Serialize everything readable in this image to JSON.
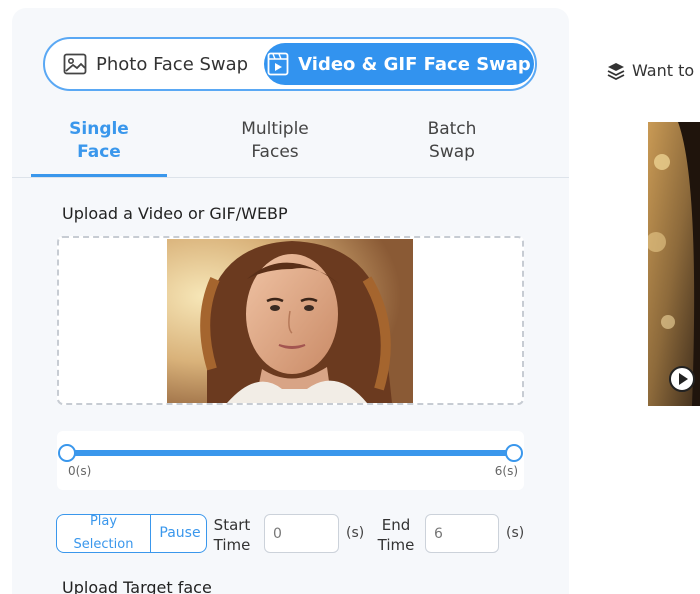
{
  "mode_toggle": {
    "photo_label": "Photo Face Swap",
    "video_label": "Video & GIF Face Swap",
    "active": "video"
  },
  "tabs": [
    {
      "line1": "Single",
      "line2": "Face",
      "active": true
    },
    {
      "line1": "Multiple",
      "line2": "Faces",
      "active": false
    },
    {
      "line1": "Batch",
      "line2": "Swap",
      "active": false
    }
  ],
  "upload": {
    "label": "Upload a Video or GIF/WEBP"
  },
  "trim": {
    "start_label": "0(s)",
    "end_label": "6(s)",
    "selection_fraction": [
      0,
      1
    ],
    "play_line1": "Play",
    "play_line2": "Selection",
    "pause_label": "Pause",
    "start_time_line1": "Start",
    "start_time_line2": "Time",
    "start_value": "0",
    "end_time_line1": "End",
    "end_time_line2": "Time",
    "end_value": "6",
    "unit": "(s)"
  },
  "target": {
    "label": "Upload Target face"
  },
  "side": {
    "want_text": "Want to"
  },
  "colors": {
    "accent": "#3293ef",
    "tab_active": "#3a97ec",
    "panel_bg": "#f6f8fb"
  },
  "icons": {
    "photo": "image-icon",
    "video": "video-frame-icon",
    "want": "layers-icon",
    "play": "play-circle-icon"
  }
}
